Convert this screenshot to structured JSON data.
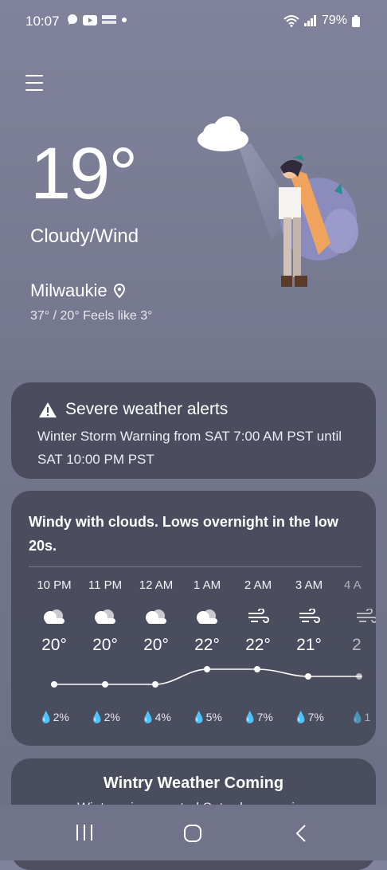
{
  "status": {
    "time": "10:07",
    "battery": "79%"
  },
  "current": {
    "temperature": "19°",
    "condition": "Cloudy/Wind",
    "location": "Milwaukie",
    "range_feels": "37° / 20° Feels like 3°"
  },
  "alert": {
    "title": "Severe weather alerts",
    "text": "Winter Storm Warning from SAT 7:00 AM PST until SAT 10:00 PM PST"
  },
  "forecast": {
    "summary": "Windy with clouds. Lows overnight in the low 20s.",
    "hours": [
      {
        "time": "10 PM",
        "icon": "cloud-icon",
        "temp": "20°",
        "precip": "2%"
      },
      {
        "time": "11 PM",
        "icon": "cloud-icon",
        "temp": "20°",
        "precip": "2%"
      },
      {
        "time": "12 AM",
        "icon": "cloud-icon",
        "temp": "20°",
        "precip": "4%"
      },
      {
        "time": "1 AM",
        "icon": "cloud-icon",
        "temp": "22°",
        "precip": "5%"
      },
      {
        "time": "2 AM",
        "icon": "wind-icon",
        "temp": "22°",
        "precip": "7%"
      },
      {
        "time": "3 AM",
        "icon": "wind-icon",
        "temp": "21°",
        "precip": "7%"
      },
      {
        "time": "4 A",
        "icon": "wind-icon",
        "temp": "2",
        "precip": "1"
      }
    ]
  },
  "wintry": {
    "title": "Wintry Weather Coming",
    "subtitle": "Wintry mix expected Saturday morning"
  }
}
